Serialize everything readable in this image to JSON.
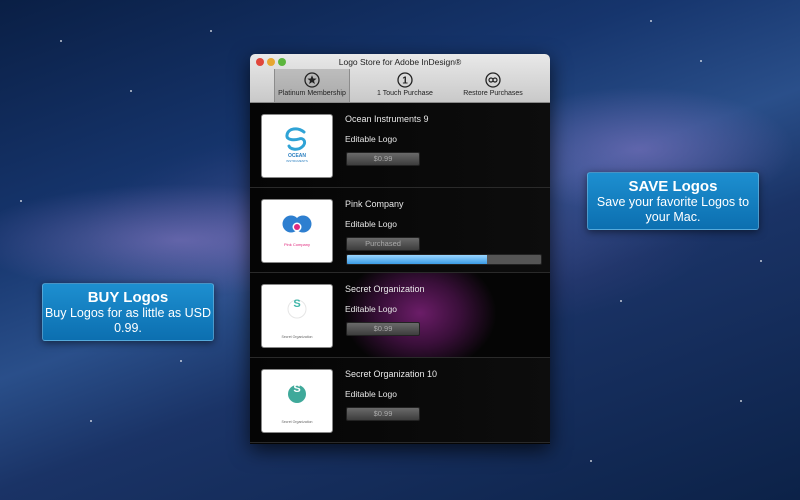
{
  "window": {
    "title": "Logo Store for Adobe InDesign®",
    "tabs": [
      {
        "label": "Platinum Membership",
        "icon": "star-icon",
        "active": true
      },
      {
        "label": "1 Touch Purchase",
        "icon": "one-touch-icon",
        "active": false
      },
      {
        "label": "Restore Purchases",
        "icon": "restore-icon",
        "active": false
      }
    ]
  },
  "items": [
    {
      "name": "Ocean Instruments 9",
      "subtitle": "Editable Logo",
      "price": "$0.99",
      "logo_text": "OCEAN",
      "logo_caption": "INSTRUMENTS",
      "logo_icon": "ocean-swirl-icon",
      "purchased": false
    },
    {
      "name": "Pink Company",
      "subtitle": "Editable Logo",
      "price": "Purchased",
      "logo_text": "Pink Company",
      "logo_icon": "pink-circles-icon",
      "purchased": true,
      "progress": 0.72
    },
    {
      "name": "Secret Organization",
      "subtitle": "Editable Logo",
      "price": "$0.99",
      "logo_text": "S",
      "logo_caption": "Secret Organization",
      "logo_icon": "s-outline-icon",
      "purchased": false
    },
    {
      "name": "Secret Organization 10",
      "subtitle": "Editable Logo",
      "price": "$0.99",
      "logo_text": "S",
      "logo_caption": "Secret Organization",
      "logo_icon": "s-filled-icon",
      "purchased": false
    }
  ],
  "callouts": {
    "save": {
      "title": "SAVE Logos",
      "body": "Save your favorite Logos to your Mac."
    },
    "buy": {
      "title": "BUY Logos",
      "body": "Buy Logos for as little as USD 0.99."
    }
  },
  "colors": {
    "callout": "#1d8fd0",
    "progress": "#3b9be4",
    "highlight": "#6b1d68"
  }
}
